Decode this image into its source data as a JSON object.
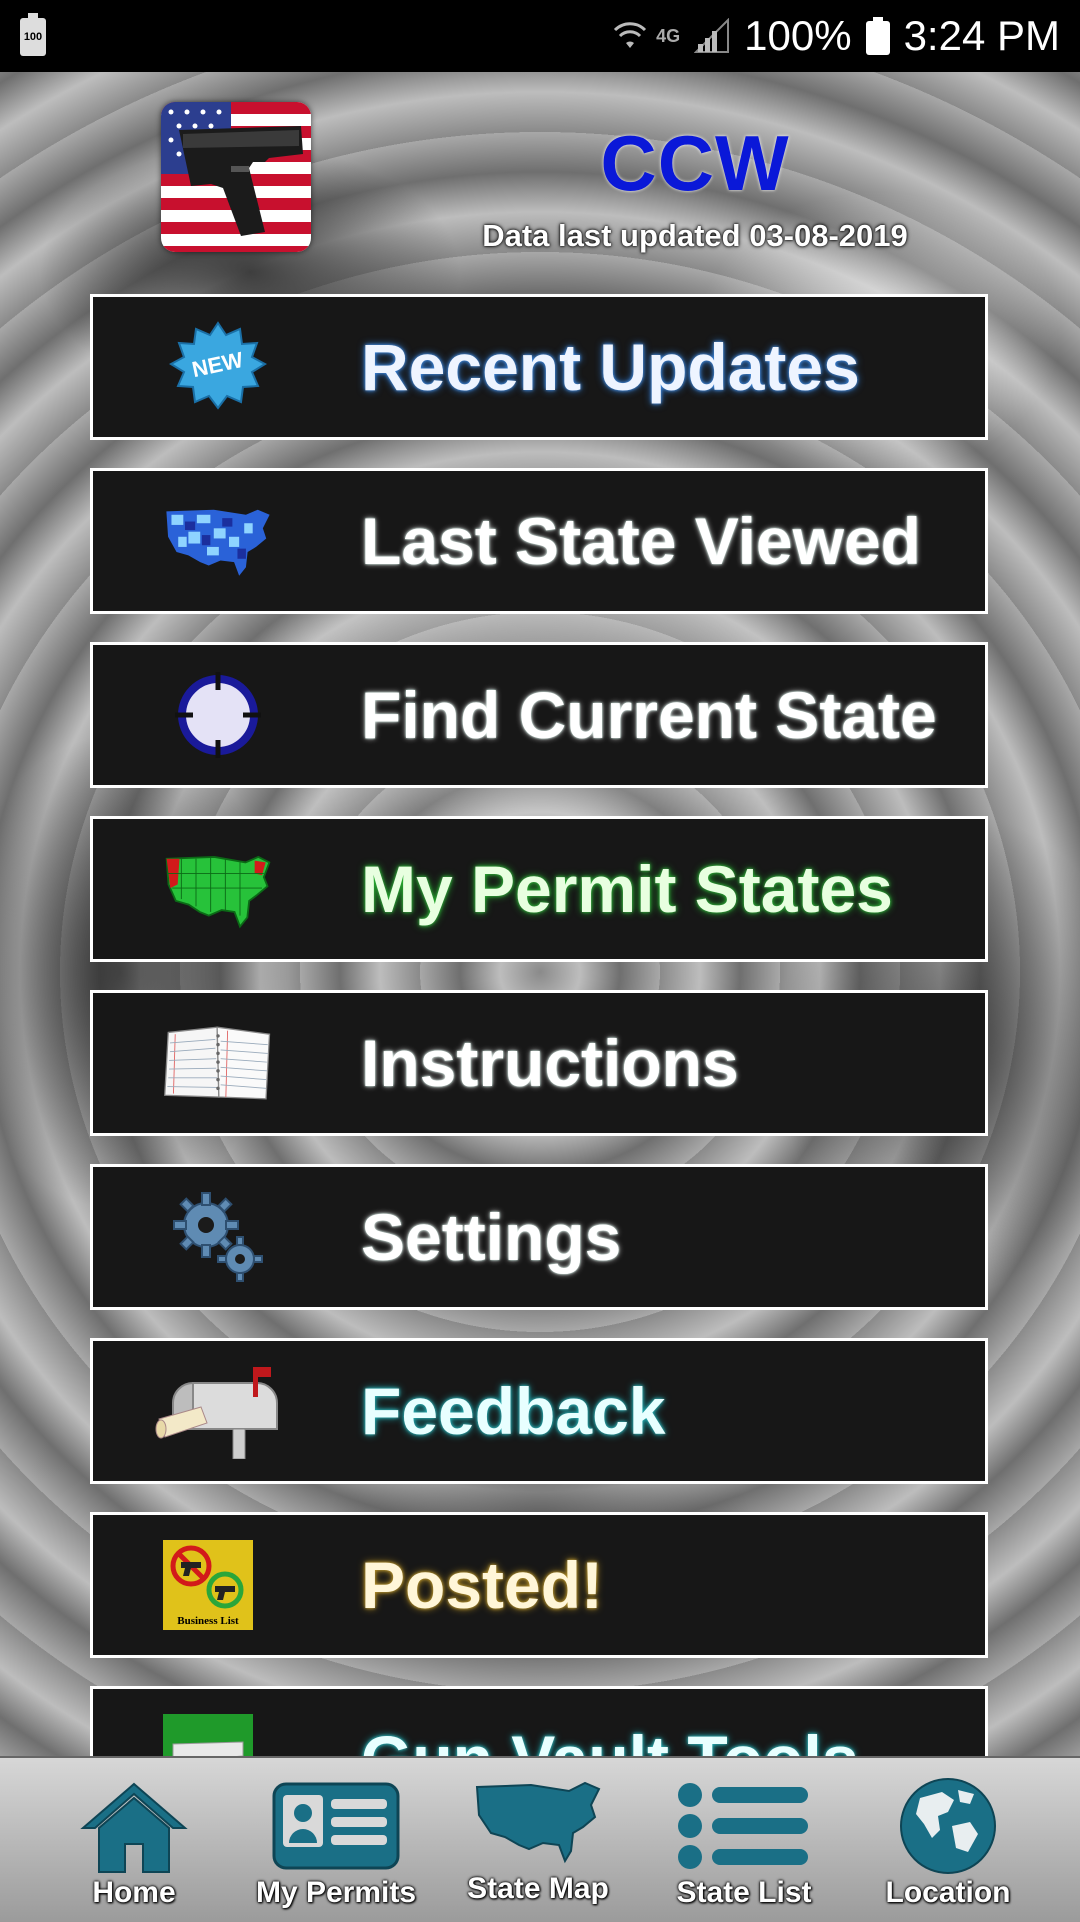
{
  "status_bar": {
    "battery_left": "100",
    "network": "4G",
    "battery_percent": "100%",
    "time": "3:24 PM"
  },
  "header": {
    "title": "CCW",
    "subtitle": "Data last updated 03-08-2019",
    "title_color": "#0a18d8"
  },
  "menu": {
    "items": [
      {
        "label": "Recent Updates",
        "icon": "new-badge-icon"
      },
      {
        "label": "Last State Viewed",
        "icon": "us-map-blue-icon"
      },
      {
        "label": "Find Current State",
        "icon": "crosshair-icon"
      },
      {
        "label": "My Permit States",
        "icon": "us-map-green-icon"
      },
      {
        "label": "Instructions",
        "icon": "notebook-icon"
      },
      {
        "label": "Settings",
        "icon": "gears-icon"
      },
      {
        "label": "Feedback",
        "icon": "mailbox-icon"
      },
      {
        "label": "Posted!",
        "icon": "business-list-icon",
        "icon_text": "Business List"
      },
      {
        "label": "Gun Vault Tools",
        "icon": "gun-vault-icon"
      }
    ]
  },
  "bottom_nav": {
    "items": [
      {
        "label": "Home",
        "icon": "home-icon"
      },
      {
        "label": "My Permits",
        "icon": "id-card-icon"
      },
      {
        "label": "State Map",
        "icon": "us-map-icon"
      },
      {
        "label": "State List",
        "icon": "list-icon"
      },
      {
        "label": "Location",
        "icon": "globe-icon"
      }
    ],
    "accent": "#1a6f86"
  }
}
